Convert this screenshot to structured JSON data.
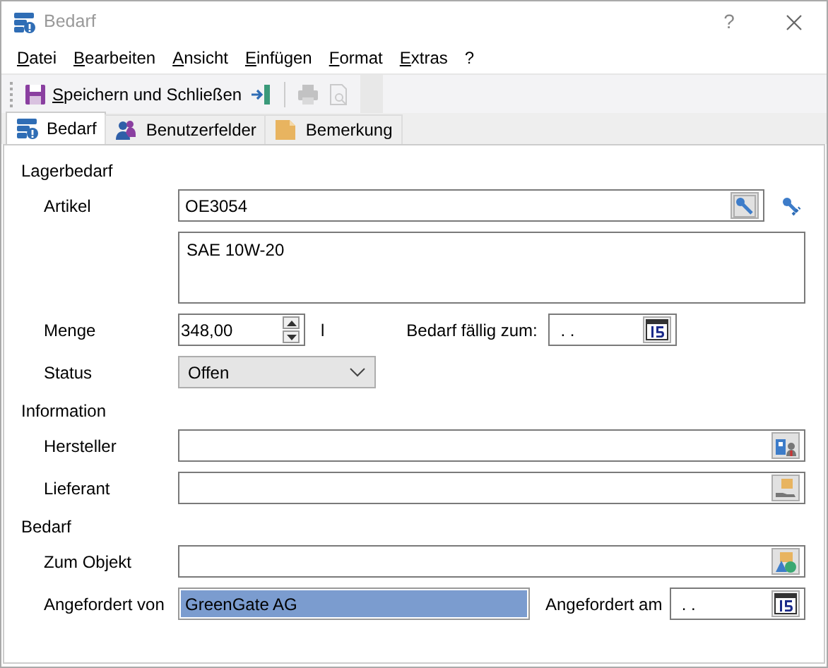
{
  "window": {
    "title": "Bedarf",
    "help": "?"
  },
  "menu": [
    "Datei",
    "Bearbeiten",
    "Ansicht",
    "Einfügen",
    "Format",
    "Extras",
    "?"
  ],
  "toolbar": [
    {
      "kind": "save",
      "label": "Speichern und Schließen",
      "disabled": false
    },
    {
      "kind": "exit",
      "disabled": false
    },
    {
      "kind": "print",
      "disabled": true
    },
    {
      "kind": "preview",
      "disabled": true
    }
  ],
  "tabs": [
    {
      "label": "Bedarf",
      "selected": true
    },
    {
      "label": "Benutzerfelder",
      "selected": false
    },
    {
      "label": "Bemerkung",
      "selected": false
    }
  ],
  "sections": [
    {
      "title": "Lagerbedarf",
      "rows": [
        {
          "kind": "lookup-edit",
          "label": "Artikel",
          "value": "OE3054"
        },
        {
          "kind": "memo",
          "value": "SAE 10W-20"
        },
        {
          "kind": "quantity",
          "label": "Menge",
          "value": "348,00",
          "unit": "l",
          "date_label": "Bedarf fällig zum:",
          "date_value": ". ."
        },
        {
          "kind": "select",
          "label": "Status",
          "value": "Offen"
        }
      ]
    },
    {
      "title": "Information",
      "rows": [
        {
          "kind": "lookup",
          "label": "Hersteller"
        },
        {
          "kind": "lookup",
          "label": "Lieferant"
        }
      ]
    },
    {
      "title": "Bedarf",
      "rows": [
        {
          "kind": "lookup",
          "label": "Zum Objekt"
        },
        {
          "kind": "text-date",
          "label": "Angefordert von",
          "value": "GreenGate AG",
          "selected": true,
          "date_label": "Angefordert am",
          "date_value": ". ."
        }
      ]
    }
  ]
}
